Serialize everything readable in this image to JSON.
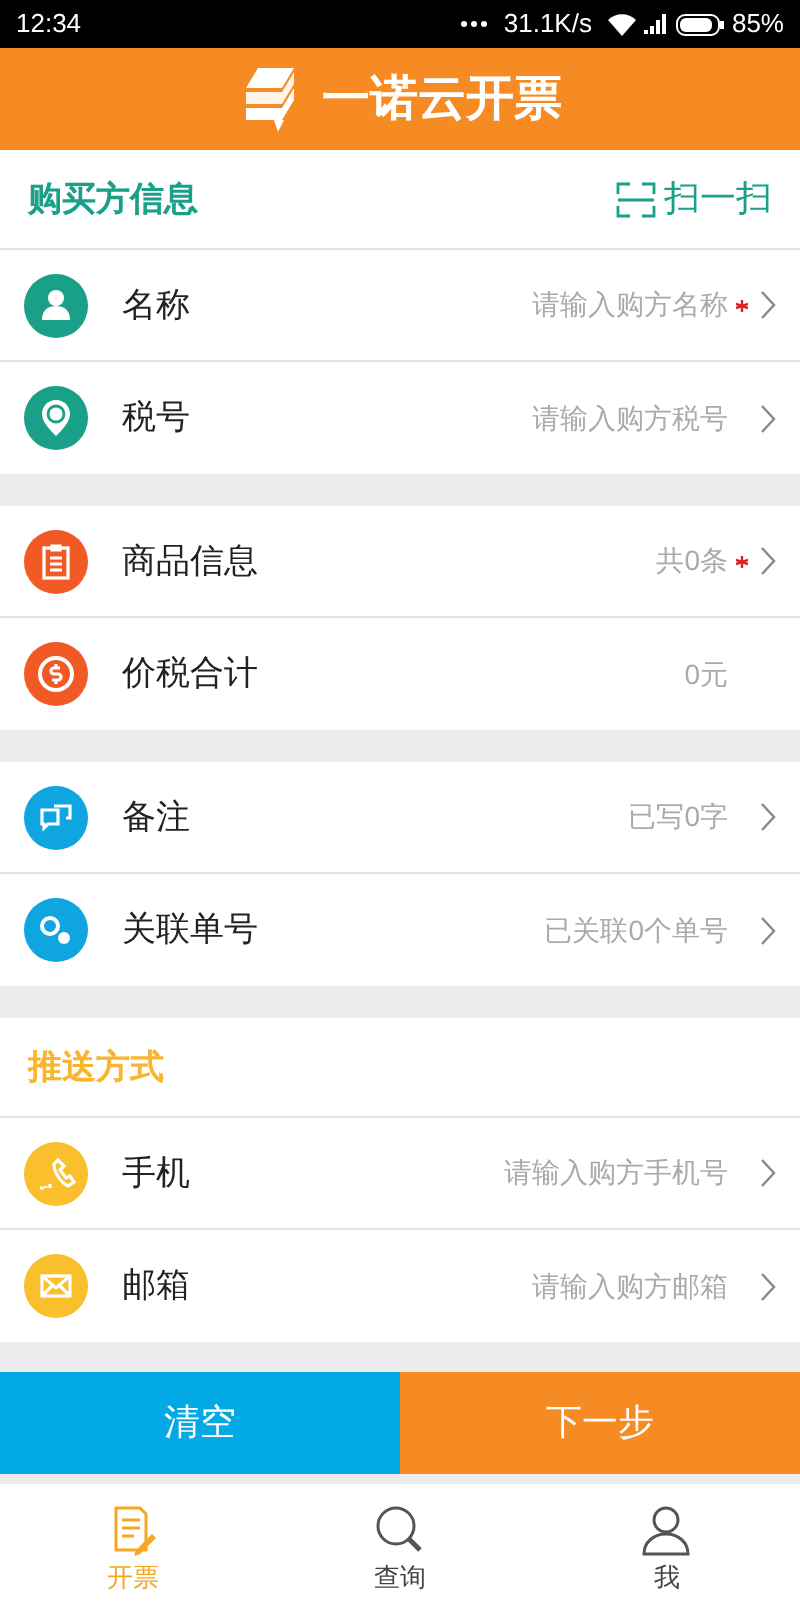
{
  "status_bar": {
    "time": "12:34",
    "speed": "31.1K/s",
    "battery": "85%"
  },
  "header": {
    "title": "一诺云开票"
  },
  "groups": [
    {
      "title": "购买方信息",
      "kind": "buyer",
      "action": "扫一扫",
      "rows": [
        {
          "kind": "person",
          "color": "#1aa089",
          "label": "名称",
          "hint": "请输入购方名称",
          "required": true,
          "arrow": true
        },
        {
          "kind": "pin",
          "color": "#1aa089",
          "label": "税号",
          "hint": "请输入购方税号",
          "required": false,
          "arrow": true
        }
      ]
    },
    {
      "kind": "plain",
      "rows": [
        {
          "kind": "clipboard",
          "color": "#f15a24",
          "label": "商品信息",
          "hint": "共0条",
          "required": true,
          "arrow": true
        },
        {
          "kind": "coin",
          "color": "#f15a24",
          "label": "价税合计",
          "hint": "0元",
          "required": false,
          "arrow": false
        }
      ]
    },
    {
      "kind": "plain",
      "rows": [
        {
          "kind": "chat",
          "color": "#0ea5e0",
          "label": "备注",
          "hint": "已写0字",
          "required": false,
          "arrow": true
        },
        {
          "kind": "link",
          "color": "#0ea5e0",
          "label": "关联单号",
          "hint": "已关联0个单号",
          "required": false,
          "arrow": true
        }
      ]
    },
    {
      "title": "推送方式",
      "kind": "push",
      "rows": [
        {
          "kind": "phone",
          "color": "#f9bf2c",
          "label": "手机",
          "hint": "请输入购方手机号",
          "required": false,
          "arrow": true
        },
        {
          "kind": "mail",
          "color": "#f9bf2c",
          "label": "邮箱",
          "hint": "请输入购方邮箱",
          "required": false,
          "arrow": true
        }
      ]
    }
  ],
  "actions": [
    {
      "label": "清空",
      "kind": "clear"
    },
    {
      "label": "下一步",
      "kind": "next"
    }
  ],
  "tabs": [
    {
      "label": "开票",
      "kind": "invoice",
      "selected": true
    },
    {
      "label": "查询",
      "kind": "search",
      "selected": false
    },
    {
      "label": "我",
      "kind": "user",
      "selected": false
    }
  ]
}
